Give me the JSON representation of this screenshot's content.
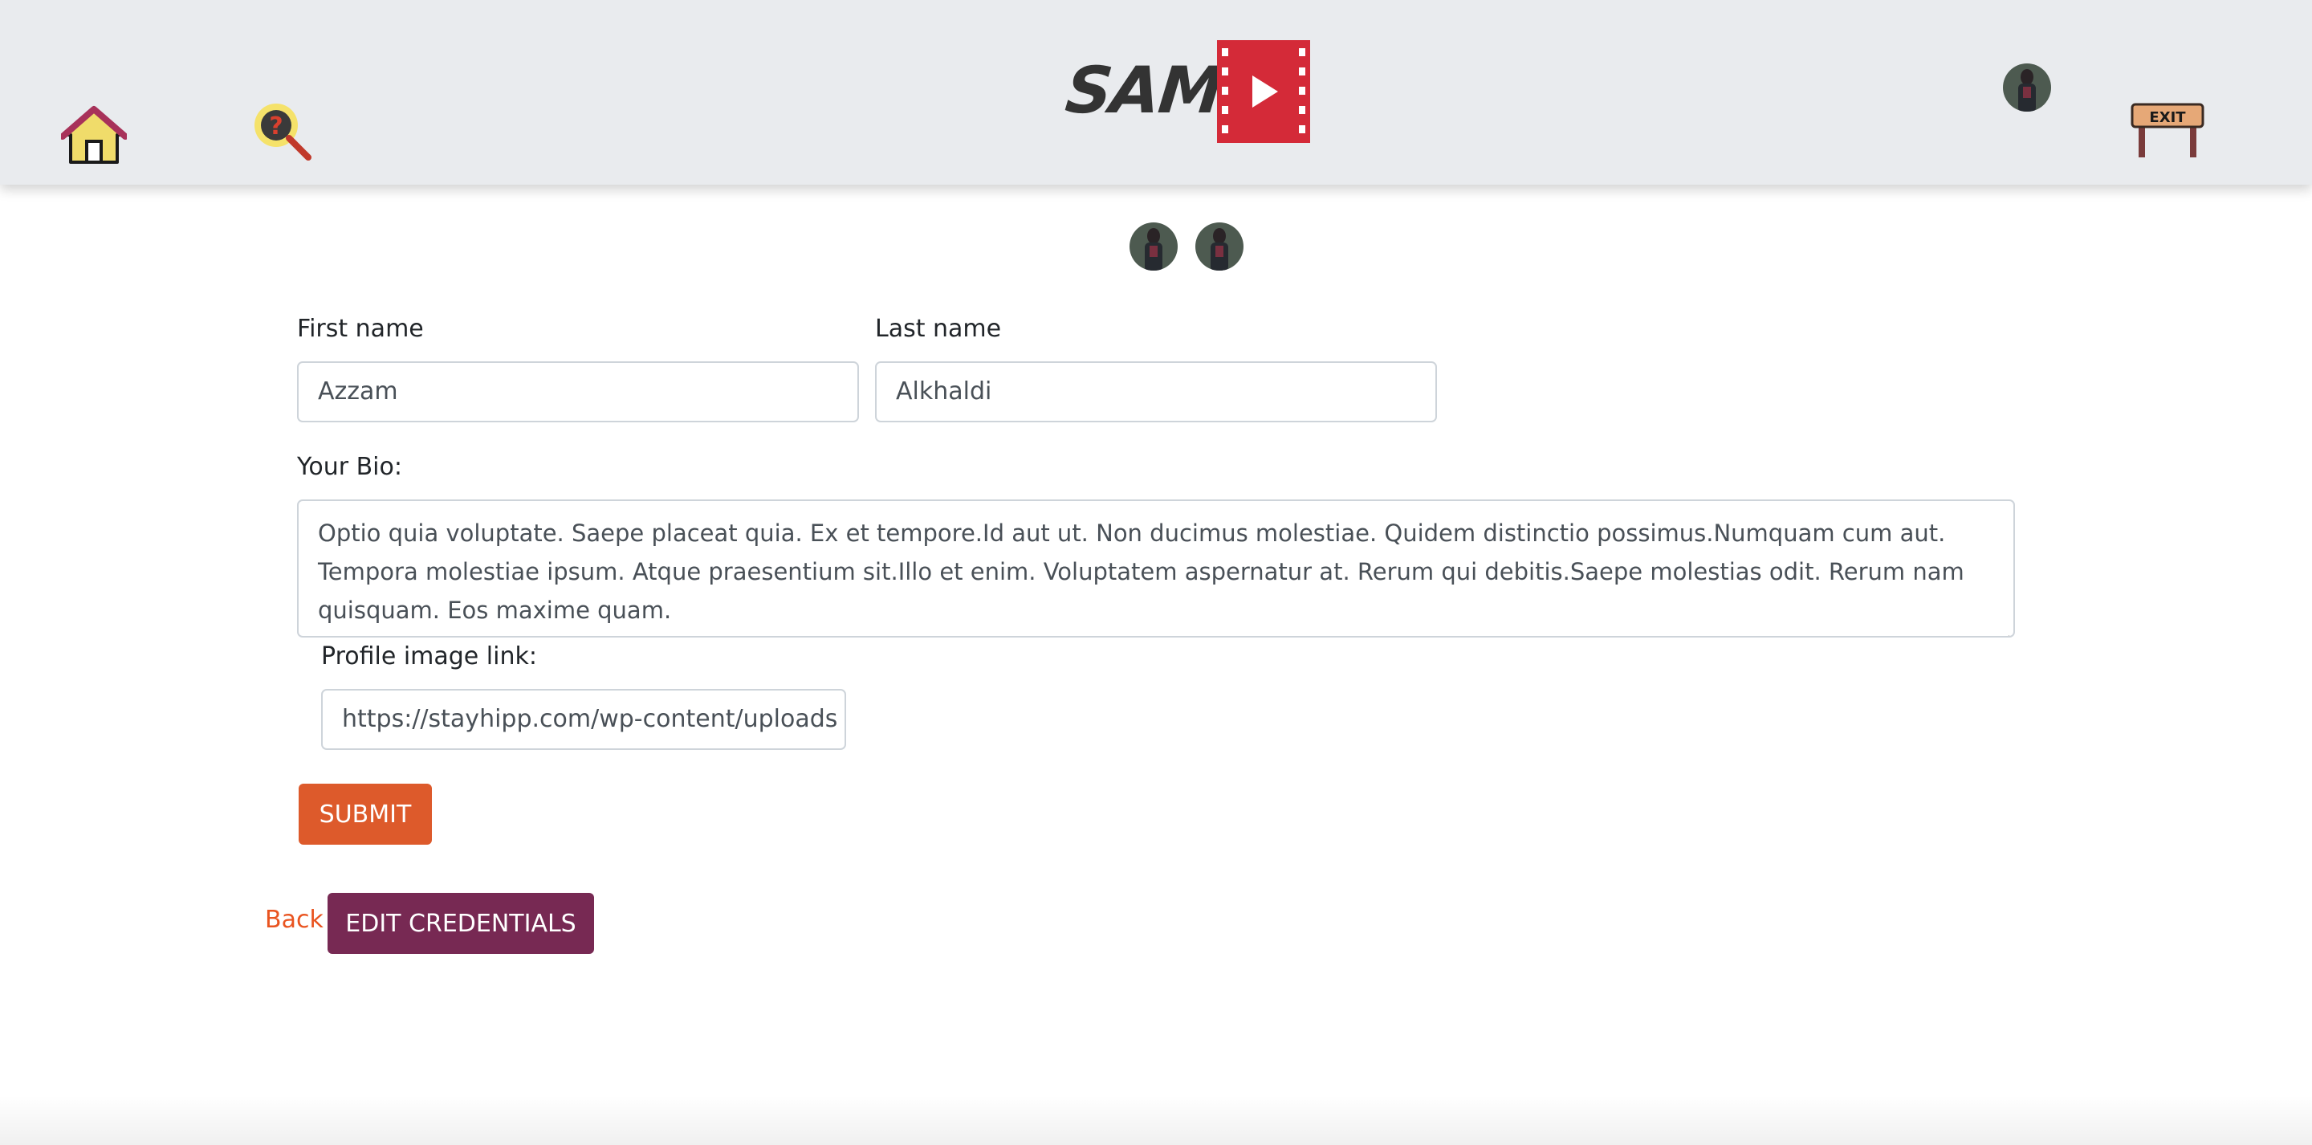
{
  "header": {
    "logo_text": "SAMG",
    "exit_sign_text": "EXIT",
    "icons": {
      "home": "home-icon",
      "help": "help-search-icon",
      "exit": "exit-sign-icon"
    }
  },
  "form": {
    "first_name_label": "First name",
    "first_name_value": "Azzam",
    "last_name_label": "Last name",
    "last_name_value": "Alkhaldi",
    "bio_label": "Your Bio:",
    "bio_value": "Optio quia voluptate. Saepe placeat quia. Ex et tempore.Id aut ut. Non ducimus molestiae. Quidem distinctio possimus.Numquam cum aut. Tempora molestiae ipsum. Atque praesentium sit.Illo et enim. Voluptatem aspernatur at. Rerum qui debitis.Saepe molestias odit. Rerum nam quisquam. Eos maxime quam.",
    "profile_image_label": "Profile image link:",
    "profile_image_value": "https://stayhipp.com/wp-content/uploads",
    "submit_label": "SUBMIT"
  },
  "footer_actions": {
    "back_label": "Back",
    "edit_credentials_label": "EDIT CREDENTIALS"
  },
  "colors": {
    "header_bg": "#e9ebee",
    "submit": "#dd5a2b",
    "edit_credentials": "#772953",
    "back_link": "#e95420",
    "logo_red": "#d42a38"
  }
}
